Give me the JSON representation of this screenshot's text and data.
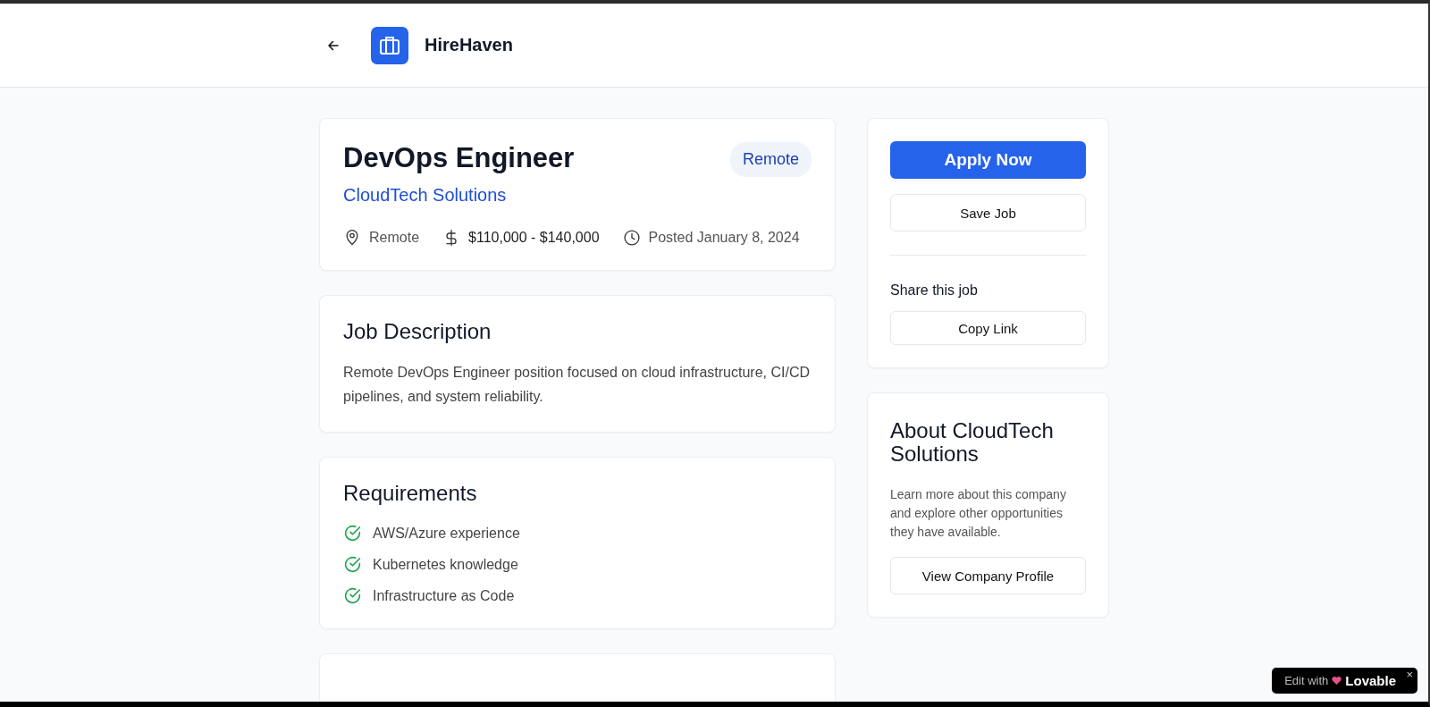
{
  "header": {
    "brand": "HireHaven"
  },
  "job": {
    "title": "DevOps Engineer",
    "company": "CloudTech Solutions",
    "badge": "Remote",
    "location": "Remote",
    "salary": "$110,000 - $140,000",
    "posted": "Posted January 8, 2024"
  },
  "description": {
    "heading": "Job Description",
    "text": "Remote DevOps Engineer position focused on cloud infrastructure, CI/CD pipelines, and system reliability."
  },
  "requirements": {
    "heading": "Requirements",
    "items": [
      "AWS/Azure experience",
      "Kubernetes knowledge",
      "Infrastructure as Code"
    ]
  },
  "actions": {
    "apply": "Apply Now",
    "save": "Save Job",
    "share_heading": "Share this job",
    "copy": "Copy Link"
  },
  "about": {
    "heading": "About CloudTech Solutions",
    "text": "Learn more about this company and explore other opportunities they have available.",
    "button": "View Company Profile"
  },
  "badge_overlay": {
    "prefix": "Edit with",
    "brand": "Lovable",
    "close": "×"
  }
}
